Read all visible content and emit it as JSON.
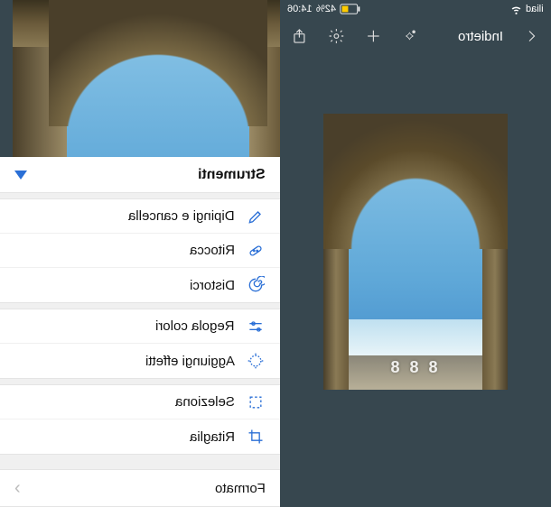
{
  "status_bar": {
    "time": "14:06",
    "battery_percent": "42%",
    "carrier": "iliad"
  },
  "toolbar": {
    "back_label": "Indietro"
  },
  "sheet": {
    "title": "Strumenti",
    "format_label": "Formato",
    "groups": [
      [
        {
          "icon": "brush-icon",
          "label": "Dipingi e cancella"
        },
        {
          "icon": "bandage-icon",
          "label": "Ritocca"
        },
        {
          "icon": "spiral-icon",
          "label": "Distorci"
        }
      ],
      [
        {
          "icon": "sliders-icon",
          "label": "Regola colori"
        },
        {
          "icon": "sparkle-icon",
          "label": "Aggiungi effetti"
        }
      ],
      [
        {
          "icon": "select-icon",
          "label": "Seleziona"
        },
        {
          "icon": "crop-icon",
          "label": "Ritaglia"
        }
      ]
    ]
  },
  "watermark": "8 8 8"
}
